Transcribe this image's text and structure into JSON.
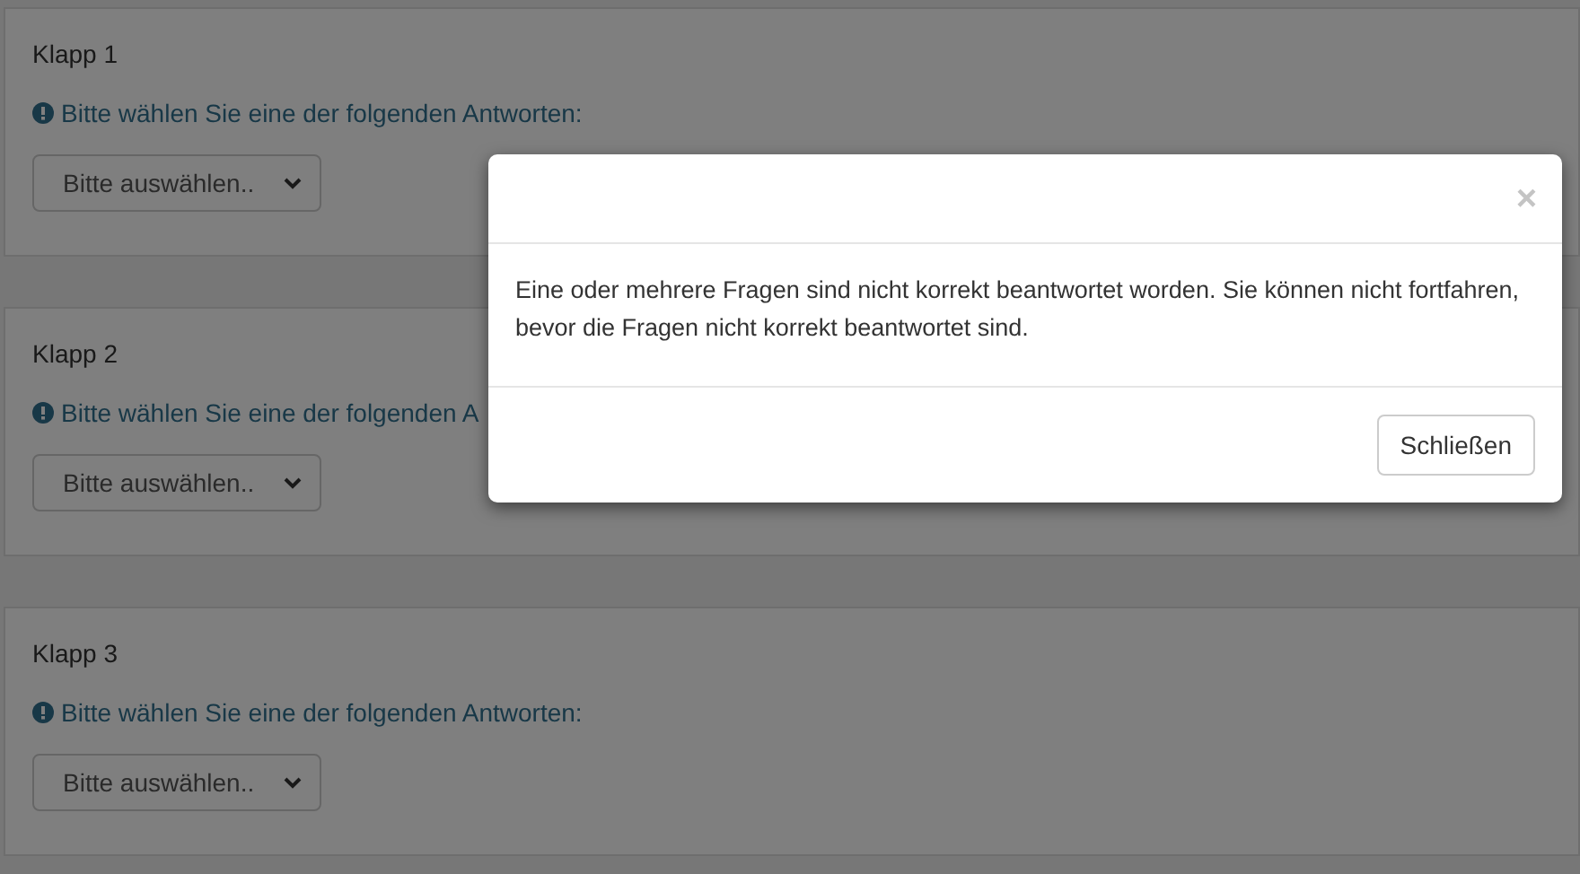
{
  "questions": [
    {
      "title": "Klapp 1",
      "hint": "Bitte wählen Sie eine der folgenden Antworten:",
      "select": {
        "value": "Bitte auswählen.."
      }
    },
    {
      "title": "Klapp 2",
      "hint": "Bitte wählen Sie eine der folgenden A",
      "select": {
        "value": "Bitte auswählen.."
      }
    },
    {
      "title": "Klapp 3",
      "hint": "Bitte wählen Sie eine der folgenden Antworten:",
      "select": {
        "value": "Bitte auswählen.."
      }
    }
  ],
  "modal": {
    "close": "×",
    "message": "Eine oder mehrere Fragen sind nicht korrekt beantwortet worden. Sie können nicht fortfahren, bevor die Fragen nicht korrekt beantwortet sind.",
    "button": "Schließen"
  }
}
